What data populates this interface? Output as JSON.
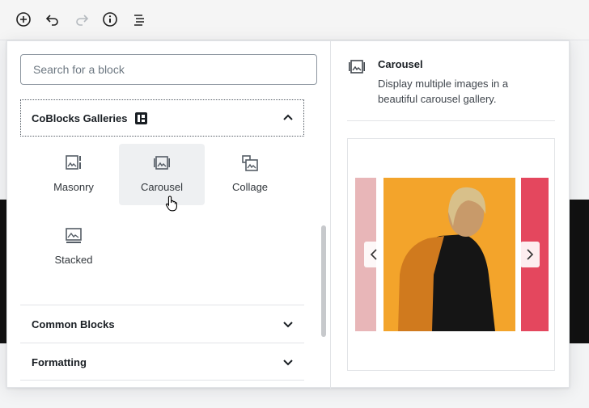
{
  "toolbar": {
    "add_icon": "plus-circle-icon",
    "undo_icon": "undo-icon",
    "redo_icon": "redo-icon",
    "info_icon": "info-icon",
    "outline_icon": "list-icon"
  },
  "inserter": {
    "search": {
      "placeholder": "Search for a block",
      "value": ""
    },
    "panels": [
      {
        "title": "CoBlocks Galleries",
        "expanded": true,
        "items": [
          {
            "label": "Masonry",
            "icon": "masonry-icon"
          },
          {
            "label": "Carousel",
            "icon": "carousel-icon",
            "hovered": true
          },
          {
            "label": "Collage",
            "icon": "collage-icon"
          },
          {
            "label": "Stacked",
            "icon": "stacked-icon"
          }
        ]
      },
      {
        "title": "Common Blocks",
        "expanded": false
      },
      {
        "title": "Formatting",
        "expanded": false
      }
    ]
  },
  "preview": {
    "icon": "carousel-icon",
    "title": "Carousel",
    "description": "Display multiple images in a beautiful carousel gallery."
  },
  "colors": {
    "accent": "#191e23",
    "hover_bg": "#eef0f2",
    "slide_main": "#f3a42b",
    "slide_right": "#e4475e"
  }
}
